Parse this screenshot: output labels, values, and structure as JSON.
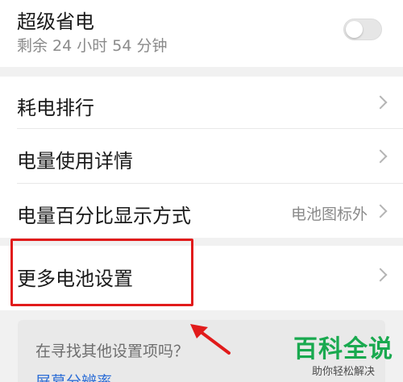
{
  "super_saver": {
    "title": "超级省电",
    "remaining": "剩余 24 小时 54 分钟",
    "enabled": false
  },
  "menu": {
    "items": [
      {
        "label": "耗电排行",
        "value": ""
      },
      {
        "label": "电量使用详情",
        "value": ""
      },
      {
        "label": "电量百分比显示方式",
        "value": "电池图标外"
      }
    ]
  },
  "more": {
    "label": "更多电池设置"
  },
  "search_suggest": {
    "prompt": "在寻找其他设置项吗？",
    "link": "屏幕分辨率"
  },
  "watermark": {
    "main": "百科全说",
    "sub": "助你轻松解决"
  },
  "colors": {
    "highlight": "#e11b1b",
    "link": "#2f6fd6",
    "watermark": "#19a94f"
  }
}
